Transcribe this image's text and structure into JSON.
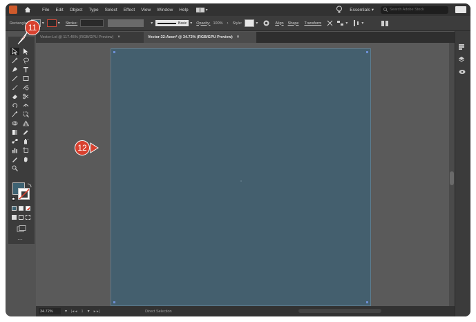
{
  "menu": {
    "items": [
      "File",
      "Edit",
      "Object",
      "Type",
      "Select",
      "Effect",
      "View",
      "Window",
      "Help"
    ],
    "workspace": "Essentials",
    "search_placeholder": "Search Adobe Stock"
  },
  "control_bar": {
    "selection_label": "Rectangle",
    "stroke_label": "Stroke:",
    "brush_value": "Basic",
    "opacity_label": "Opacity:",
    "opacity_value": "100%",
    "style_label": "Style:",
    "align_label": "Align",
    "shape_label": "Shape",
    "transform_label": "Transform",
    "fill_color": "#3e6373"
  },
  "tabs": [
    {
      "label": "Vector-Lol @ 117.45% (RGB/GPU Preview)",
      "active": false
    },
    {
      "label": "Vector-32-Aeon* @ 34.72% (RGB/GPU Preview)",
      "active": true
    }
  ],
  "status": {
    "zoom": "34.72%",
    "artboard": "1",
    "tool_name": "Direct Selection"
  },
  "callouts": {
    "c11": "11",
    "c12": "12"
  },
  "colors": {
    "artboard": "#445f6e",
    "callout": "#d8412f",
    "canvas": "#5a5a5a"
  },
  "panels": [
    "Properties",
    "Layers",
    "Libraries"
  ]
}
